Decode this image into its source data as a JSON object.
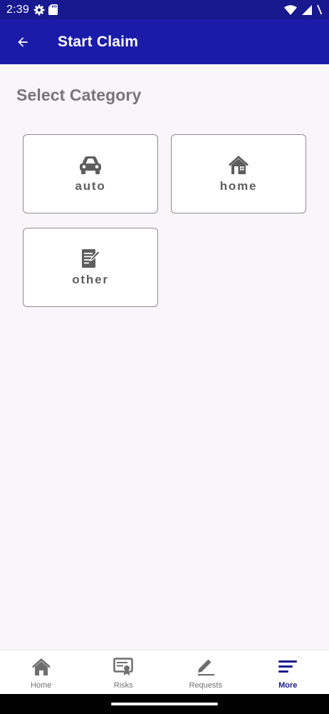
{
  "status_bar": {
    "time": "2:39",
    "icons": [
      "settings-gear-icon",
      "sd-card-icon",
      "wifi-icon",
      "cellular-signal-icon",
      "battery-icon"
    ]
  },
  "app_bar": {
    "title": "Start Claim",
    "back_icon": "arrow-left-icon",
    "background": "#1b1baa"
  },
  "main": {
    "section_title": "Select Category",
    "categories": [
      {
        "label": "auto",
        "icon": "car-icon"
      },
      {
        "label": "home",
        "icon": "house-icon"
      },
      {
        "label": "other",
        "icon": "document-edit-icon"
      }
    ]
  },
  "bottom_nav": {
    "items": [
      {
        "label": "Home",
        "icon": "home-icon",
        "active": false
      },
      {
        "label": "Risks",
        "icon": "certificate-icon",
        "active": false
      },
      {
        "label": "Requests",
        "icon": "pencil-icon",
        "active": false
      },
      {
        "label": "More",
        "icon": "menu-lines-icon",
        "active": true
      }
    ],
    "active_color": "#1b1b8f",
    "inactive_color": "#707070"
  }
}
